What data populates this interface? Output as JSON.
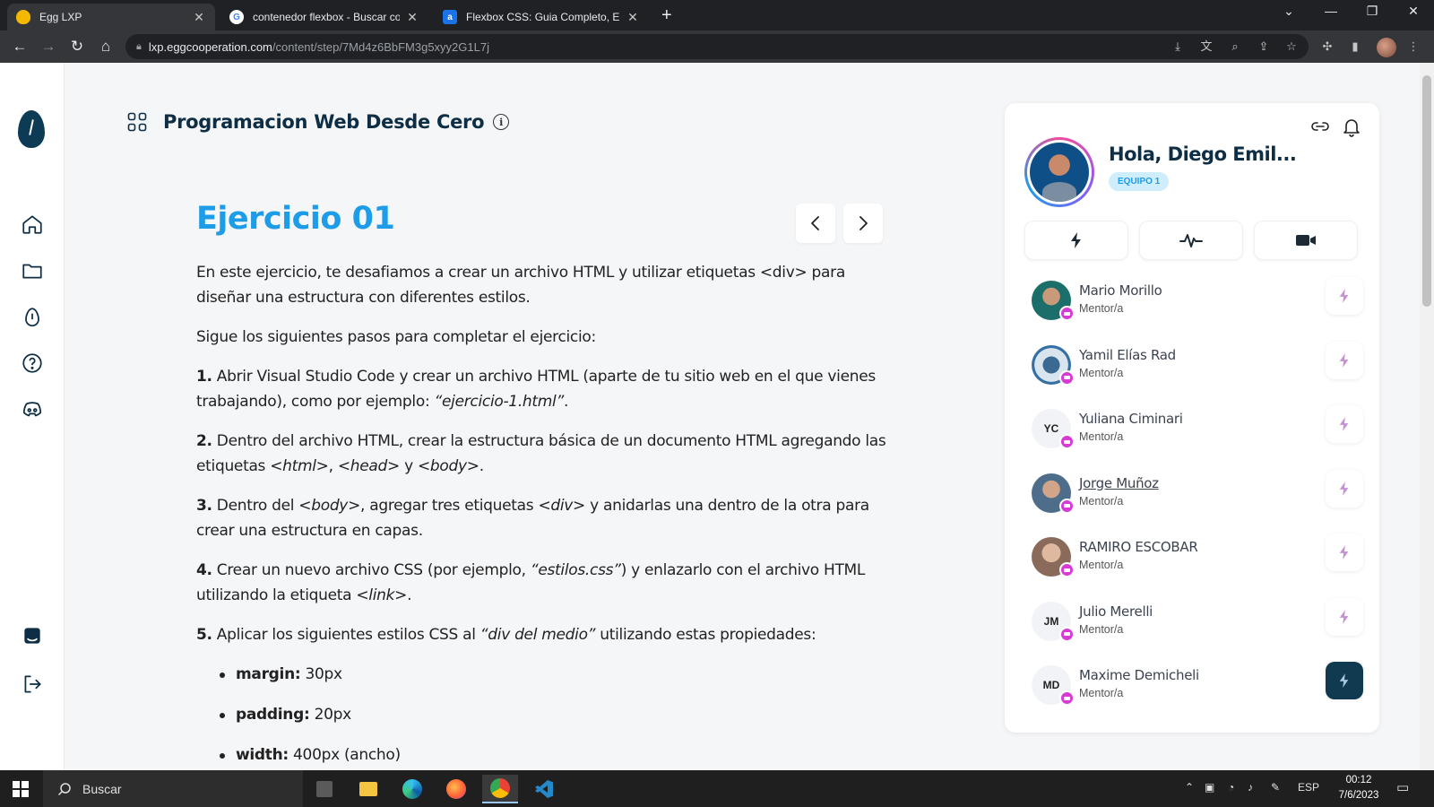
{
  "browser": {
    "tabs": [
      {
        "title": "Egg LXP",
        "favicon_color": "#f5b800"
      },
      {
        "title": "contenedor flexbox - Buscar con",
        "favicon_color": "#4285f4"
      },
      {
        "title": "Flexbox CSS: Guia Completo, Ele",
        "favicon_color": "#1a73e8"
      }
    ],
    "url_host": "lxp.eggcooperation.com",
    "url_path": "/content/step/7Md4z6BbFM3g5xyy2G1L7j"
  },
  "course": {
    "title": "Programacion Web Desde Cero",
    "exercise_title": "Ejercicio 01"
  },
  "content": {
    "intro": "En este ejercicio, te desafiamos a crear un archivo HTML y utilizar etiquetas <div> para diseñar una estructura con diferentes estilos.",
    "lead": "Sigue los siguientes pasos para completar el ejercicio:",
    "step1": {
      "num": "1.",
      "text": " Abrir Visual Studio Code y crear un archivo HTML (aparte de tu sitio web en el que vienes trabajando), como por ejemplo: ",
      "em": "“ejercicio-1.html”",
      "tail": "."
    },
    "step2": {
      "num": "2.",
      "text": " Dentro del archivo HTML, crear la estructura básica de un documento HTML agregando las etiquetas ",
      "em1": "<html>",
      "sep1": ", ",
      "em2": "<head>",
      "sep2": " y ",
      "em3": "<body>",
      "tail": "."
    },
    "step3": {
      "num": "3.",
      "text": " Dentro del ",
      "em1": "<body>",
      "mid": ", agregar tres etiquetas ",
      "em2": "<div>",
      "tail": " y anidarlas una dentro de la otra para crear una estructura en capas."
    },
    "step4": {
      "num": "4.",
      "text": " Crear un nuevo archivo CSS (por ejemplo, ",
      "em1": "“estilos.css”",
      "mid": ") y enlazarlo con el archivo HTML utilizando la etiqueta ",
      "em2": "<link>",
      "tail": "."
    },
    "step5": {
      "num": "5.",
      "text": " Aplicar los siguientes estilos CSS al ",
      "em": "“div del medio”",
      "tail": " utilizando estas propiedades:"
    },
    "props": [
      {
        "name": "margin:",
        "value": " 30px"
      },
      {
        "name": "padding:",
        "value": " 20px"
      },
      {
        "name": "width:",
        "value": " 400px (ancho)"
      }
    ]
  },
  "panel": {
    "greeting": "Hola, Diego Emil...",
    "team": "EQUIPO 1",
    "mentors": [
      {
        "name": "Mario Morillo",
        "role": "Mentor/a",
        "initials": ""
      },
      {
        "name": "Yamil Elías Rad",
        "role": "Mentor/a",
        "initials": ""
      },
      {
        "name": "Yuliana Ciminari",
        "role": "Mentor/a",
        "initials": "YC"
      },
      {
        "name": "Jorge Muñoz",
        "role": "Mentor/a",
        "initials": ""
      },
      {
        "name": "RAMIRO ESCOBAR",
        "role": "Mentor/a",
        "initials": ""
      },
      {
        "name": "Julio Merelli",
        "role": "Mentor/a",
        "initials": "JM"
      },
      {
        "name": "Maxime Demicheli",
        "role": "Mentor/a",
        "initials": "MD"
      }
    ]
  },
  "taskbar": {
    "search_label": "Buscar",
    "lang": "ESP",
    "time": "00:12",
    "date": "7/6/2023"
  },
  "colors": {
    "accent": "#1d9ce8",
    "dark_navy": "#0d2e44",
    "mentor_badge": "#d63bd6",
    "active_action": "#0f3a50"
  }
}
